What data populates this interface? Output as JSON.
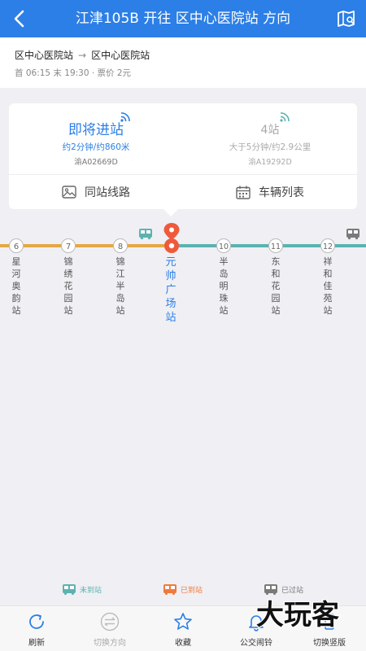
{
  "header": {
    "title": "江津105B 开往 区中心医院站 方向"
  },
  "route_info": {
    "from": "区中心医院站",
    "arrow": "→",
    "to": "区中心医院站",
    "schedule": "首 06:15 末 19:30 · 票价 2元"
  },
  "arrival": {
    "next_bus": {
      "status": "即将进站",
      "detail": "约2分钟/约860米",
      "plate": "渝A02669D"
    },
    "second_bus": {
      "status": "4站",
      "detail": "大于5分钟/约2.9公里",
      "plate": "渝A19292D"
    },
    "same_station_lines_label": "同站线路",
    "vehicle_list_label": "车辆列表"
  },
  "line": {
    "current_station_index": 3,
    "passed_color": "#e3a845",
    "upcoming_color": "#5bb3b0",
    "stations": [
      {
        "number": "6",
        "name": "星河奥韵站"
      },
      {
        "number": "7",
        "name": "锦绣花园站"
      },
      {
        "number": "8",
        "name": "锦江半岛站"
      },
      {
        "number": "",
        "name": "元帅广场站"
      },
      {
        "number": "10",
        "name": "半岛明珠站"
      },
      {
        "number": "11",
        "name": "东和花园站"
      },
      {
        "number": "12",
        "name": "祥和佳苑站"
      }
    ]
  },
  "legend": {
    "not_arrived": "未到站",
    "arrived": "已到站",
    "passed": "已过站"
  },
  "bottom_nav": {
    "refresh": "刷新",
    "switch_direction": "切换方向",
    "favorite": "收藏",
    "bus_alarm": "公交闹铃",
    "switch_vertical": "切换竖版"
  },
  "colors": {
    "primary": "#2c7fe6",
    "arrived": "#f07a3c",
    "passed": "#7a7a7a",
    "marker": "#ef5a3a"
  },
  "watermark": {
    "text": "大玩客"
  }
}
